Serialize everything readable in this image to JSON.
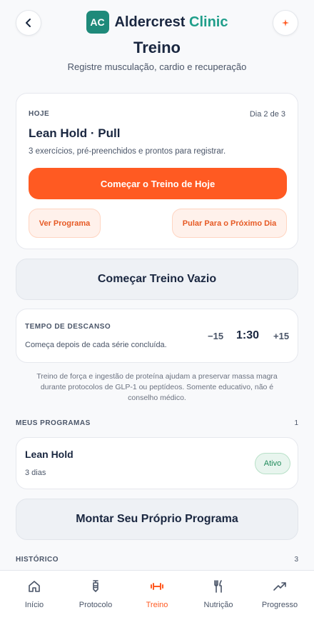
{
  "header": {
    "logo_text": "AC",
    "brand_primary": "Aldercrest",
    "brand_accent": "Clinic",
    "title": "Treino",
    "subtitle": "Registre musculação, cardio e recuperação"
  },
  "today": {
    "label": "HOJE",
    "day_progress": "Dia 2 de 3",
    "workout_name": "Lean Hold · Pull",
    "description": "3 exercícios, pré-preenchidos e prontos para registrar.",
    "start_label": "Começar o Treino de Hoje",
    "view_program_label": "Ver Programa",
    "skip_day_label": "Pular Para o Próximo Dia"
  },
  "empty_workout_label": "Começar Treino Vazio",
  "rest": {
    "label": "TEMPO DE DESCANSO",
    "description": "Começa depois de cada série concluída.",
    "minus_label": "−15",
    "time": "1:30",
    "plus_label": "+15"
  },
  "disclaimer": "Treino de força e ingestão de proteína ajudam a preservar massa magra durante protocolos de GLP-1 ou peptídeos. Somente educativo, não é conselho médico.",
  "programs": {
    "title": "MEUS PROGRAMAS",
    "count": "1",
    "items": [
      {
        "name": "Lean Hold",
        "days": "3 dias",
        "status": "Ativo"
      }
    ],
    "build_label": "Montar Seu Próprio Programa"
  },
  "history": {
    "title": "HISTÓRICO",
    "count": "3"
  },
  "nav": {
    "items": [
      {
        "label": "Início",
        "icon": "home-icon",
        "active": false
      },
      {
        "label": "Protocolo",
        "icon": "syringe-icon",
        "active": false
      },
      {
        "label": "Treino",
        "icon": "dumbbell-icon",
        "active": true
      },
      {
        "label": "Nutrição",
        "icon": "fork-knife-icon",
        "active": false
      },
      {
        "label": "Progresso",
        "icon": "trend-up-icon",
        "active": false
      }
    ]
  },
  "colors": {
    "accent": "#ff5a22",
    "brand": "#1f8a7a",
    "active_badge": "#1f8a5a"
  }
}
